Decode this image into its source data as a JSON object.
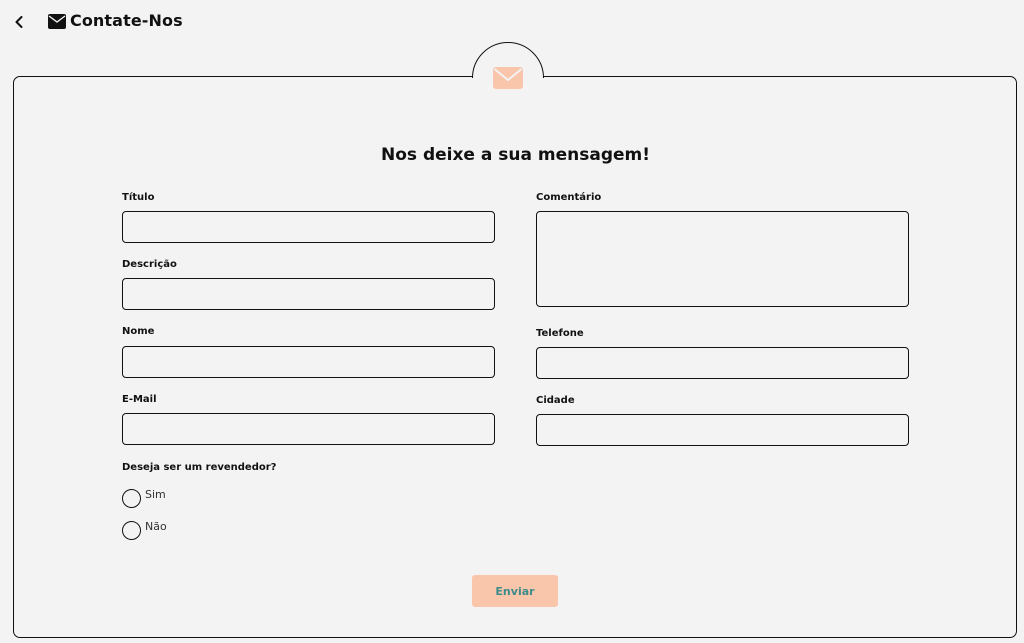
{
  "header": {
    "title": "Contate-Nos",
    "back_icon": "chevron-left-icon",
    "title_icon": "envelope-icon"
  },
  "card": {
    "top_icon": "envelope-icon",
    "accent_color": "#f9c5ab"
  },
  "form": {
    "title": "Nos deixe a sua mensagem!",
    "fields": {
      "titulo": {
        "label": "Título",
        "value": "",
        "placeholder": ""
      },
      "descricao": {
        "label": "Descrição",
        "value": "",
        "placeholder": ""
      },
      "nome": {
        "label": "Nome",
        "value": "",
        "placeholder": ""
      },
      "email": {
        "label": "E-Mail",
        "value": "",
        "placeholder": ""
      },
      "comentario": {
        "label": "Comentário",
        "value": "",
        "placeholder": ""
      },
      "telefone": {
        "label": "Telefone",
        "value": "",
        "placeholder": ""
      },
      "cidade": {
        "label": "Cidade",
        "value": "",
        "placeholder": ""
      }
    },
    "reseller": {
      "question": "Deseja ser um revendedor?",
      "options": [
        "Sim",
        "Não"
      ],
      "selected": null
    },
    "submit_label": "Enviar",
    "submit_color": "#f9c5ab",
    "submit_text_color": "#3d8c8a"
  }
}
